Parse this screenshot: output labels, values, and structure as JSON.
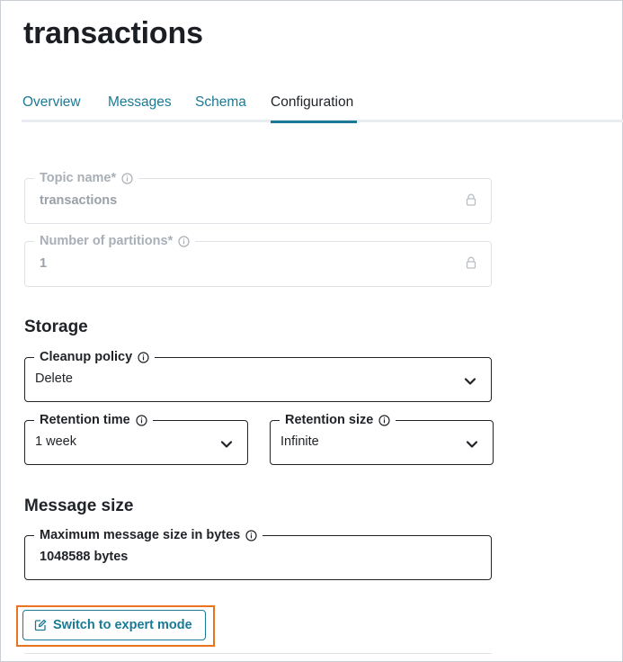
{
  "page": {
    "title": "transactions"
  },
  "tabs": [
    {
      "label": "Overview",
      "active": false
    },
    {
      "label": "Messages",
      "active": false
    },
    {
      "label": "Schema",
      "active": false
    },
    {
      "label": "Configuration",
      "active": true
    }
  ],
  "topic": {
    "name_label": "Topic name*",
    "name_value": "transactions",
    "partitions_label": "Number of partitions*",
    "partitions_value": "1"
  },
  "storage": {
    "title": "Storage",
    "cleanup_label": "Cleanup policy",
    "cleanup_value": "Delete",
    "retention_time_label": "Retention time",
    "retention_time_value": "1 week",
    "retention_size_label": "Retention size",
    "retention_size_value": "Infinite"
  },
  "message_size": {
    "title": "Message size",
    "max_label": "Maximum message size in bytes",
    "max_value": "1048588 bytes"
  },
  "actions": {
    "expert_mode_label": "Switch to expert mode"
  },
  "icons": {
    "info": "info-icon",
    "lock": "lock-icon",
    "chevron": "chevron-down-icon",
    "edit": "edit-icon"
  },
  "colors": {
    "accent": "#1a7a96",
    "highlight": "#e97320",
    "text": "#1f2328",
    "disabled_text": "#9aa1a8"
  }
}
